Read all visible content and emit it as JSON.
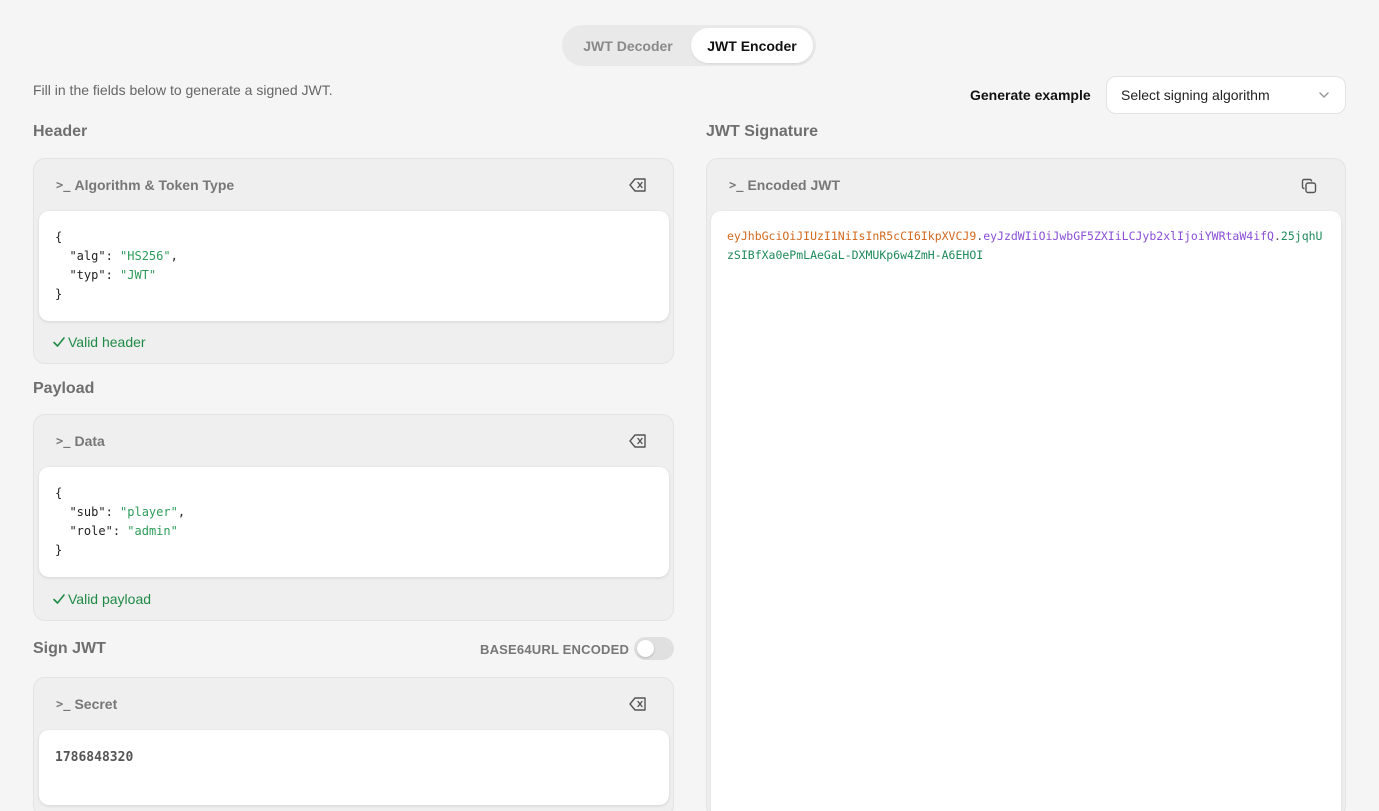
{
  "tabs": {
    "decoder": "JWT Decoder",
    "encoder": "JWT Encoder"
  },
  "intro": "Fill in the fields below to generate a signed JWT.",
  "generate": {
    "label": "Generate example",
    "select_value": "Select signing algorithm"
  },
  "header_section": {
    "title": "Header",
    "panel_title": "Algorithm & Token Type",
    "lines": [
      "{",
      "\"alg\": \"HS256\",",
      "\"typ\": \"JWT\"",
      "}"
    ],
    "alg_key": "\"alg\"",
    "alg_val": "\"HS256\"",
    "typ_key": "\"typ\"",
    "typ_val": "\"JWT\"",
    "status": "Valid header"
  },
  "payload_section": {
    "title": "Payload",
    "panel_title": "Data",
    "sub_key": "\"sub\"",
    "sub_val": "\"player\"",
    "role_key": "\"role\"",
    "role_val": "\"admin\"",
    "status": "Valid payload"
  },
  "sign_section": {
    "title": "Sign JWT",
    "toggle_label": "BASE64URL ENCODED",
    "toggle_on": false,
    "panel_title": "Secret",
    "secret": "1786848320"
  },
  "signature_section": {
    "title": "JWT Signature",
    "panel_title": "Encoded JWT",
    "jwt_header": "eyJhbGciOiJIUzI1NiIsInR5cCI6IkpXVCJ9",
    "jwt_payload": "eyJzdWIiOiJwbGF5ZXIiLCJyb2xlIjoiYWRtaW4ifQ",
    "jwt_signature": "25jqhUzSIBfXa0ePmLAeGaL-DXMUKp6w4ZmH-A6EHOI"
  },
  "colors": {
    "valid": "#1f8a46",
    "jwt_header": "#d2691e",
    "jwt_payload": "#8a4fd6",
    "jwt_signature": "#1f8a5a"
  },
  "icons": {
    "prompt": "terminal-prompt-icon",
    "clear": "backspace-clear-icon",
    "copy": "copy-icon",
    "check": "check-icon",
    "chevron": "chevron-down-icon"
  }
}
